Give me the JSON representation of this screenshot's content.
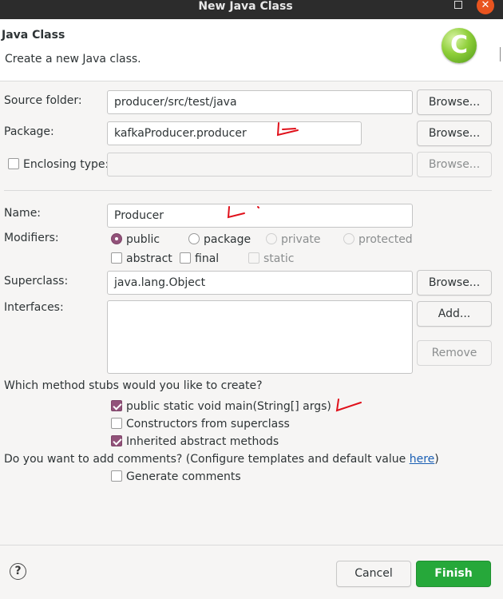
{
  "window": {
    "title": "New Java Class",
    "close_glyph": "✕"
  },
  "header": {
    "title": "Java Class",
    "description": "Create a new Java class.",
    "icon": "java-class-c-icon",
    "icon_letter": "C"
  },
  "source_folder": {
    "label": "Source folder:",
    "value": "producer/src/test/java",
    "browse": "Browse..."
  },
  "package": {
    "label": "Package:",
    "value": "kafkaProducer.producer",
    "browse": "Browse..."
  },
  "enclosing_type": {
    "label": "Enclosing type:",
    "value": "",
    "browse": "Browse...",
    "checked": false
  },
  "name": {
    "label": "Name:",
    "value": "Producer"
  },
  "modifiers": {
    "label": "Modifiers:",
    "access": [
      "public",
      "package",
      "private",
      "protected"
    ],
    "access_selected": "public",
    "flags": [
      "abstract",
      "final",
      "static"
    ]
  },
  "superclass": {
    "label": "Superclass:",
    "value": "java.lang.Object",
    "browse": "Browse..."
  },
  "interfaces": {
    "label": "Interfaces:",
    "add": "Add...",
    "remove": "Remove"
  },
  "method_stubs": {
    "question": "Which method stubs would you like to create?",
    "options": [
      {
        "label": "public static void main(String[] args)",
        "checked": true
      },
      {
        "label": "Constructors from superclass",
        "checked": false
      },
      {
        "label": "Inherited abstract methods",
        "checked": true
      }
    ]
  },
  "comments": {
    "question_prefix": "Do you want to add comments? (Configure templates and default value ",
    "link": "here",
    "question_suffix": ")",
    "option": "Generate comments",
    "checked": false
  },
  "footer": {
    "help": "?",
    "cancel": "Cancel",
    "finish": "Finish"
  },
  "colors": {
    "accent": "#92527a",
    "finish": "#26a83a",
    "link": "#1a5fb4",
    "annotation": "#e0101a"
  }
}
